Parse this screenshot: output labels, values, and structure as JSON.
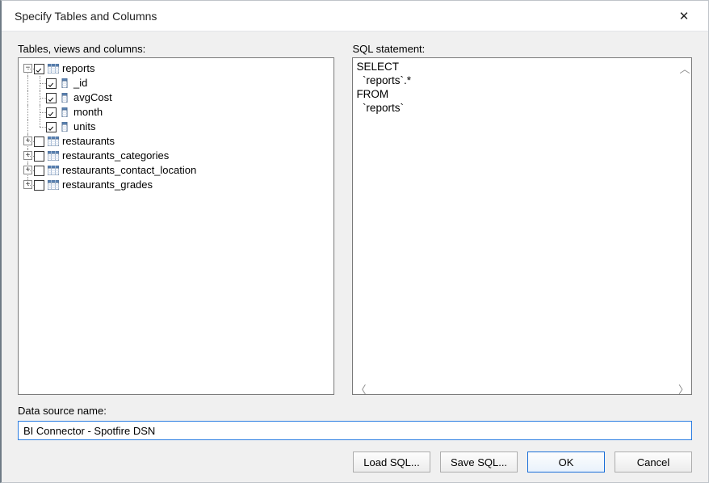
{
  "window": {
    "title": "Specify Tables and Columns"
  },
  "labels": {
    "tree": "Tables, views and columns:",
    "sql": "SQL statement:",
    "dsn": "Data source name:"
  },
  "tree": {
    "reports": {
      "label": "reports",
      "expanded": true,
      "checked": true,
      "columns": [
        {
          "label": "_id",
          "checked": true
        },
        {
          "label": "avgCost",
          "checked": true
        },
        {
          "label": "month",
          "checked": true
        },
        {
          "label": "units",
          "checked": true
        }
      ]
    },
    "others": [
      {
        "label": "restaurants",
        "checked": false,
        "expanded": false
      },
      {
        "label": "restaurants_categories",
        "checked": false,
        "expanded": false
      },
      {
        "label": "restaurants_contact_location",
        "checked": false,
        "expanded": false
      },
      {
        "label": "restaurants_grades",
        "checked": false,
        "expanded": false
      }
    ]
  },
  "sql": "SELECT\n  `reports`.*\nFROM\n  `reports`",
  "dsn": {
    "value": "BI Connector - Spotfire DSN"
  },
  "buttons": {
    "load": "Load SQL...",
    "save": "Save SQL...",
    "ok": "OK",
    "cancel": "Cancel"
  },
  "icons": {
    "close": "✕",
    "up_arrow": "︿",
    "left_arrow": "〈",
    "right_arrow": "〉",
    "minus": "−",
    "plus": "+"
  }
}
